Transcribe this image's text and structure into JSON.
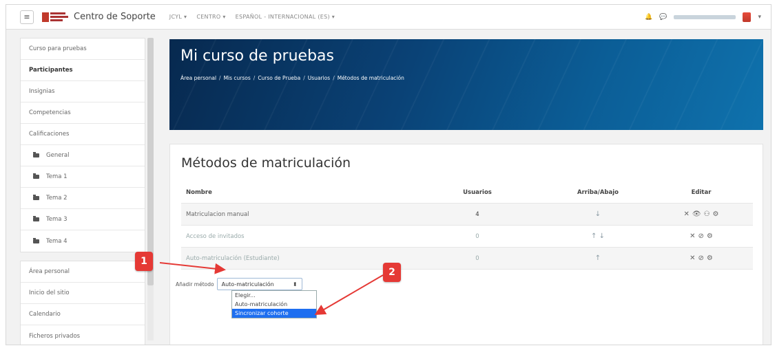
{
  "navbar": {
    "menu_icon": "≡",
    "site_name": "Centro de Soporte",
    "menus": [
      "JCYL ▾",
      "CENTRO ▾",
      "ESPAÑOL - INTERNACIONAL (ES) ▾"
    ]
  },
  "sidebar": {
    "group1": [
      {
        "label": "Curso para pruebas",
        "bold": false,
        "folder": false
      },
      {
        "label": "Participantes",
        "bold": true,
        "folder": false
      },
      {
        "label": "Insignias",
        "bold": false,
        "folder": false
      },
      {
        "label": "Competencias",
        "bold": false,
        "folder": false
      },
      {
        "label": "Calificaciones",
        "bold": false,
        "folder": false
      },
      {
        "label": "General",
        "bold": false,
        "folder": true
      },
      {
        "label": "Tema 1",
        "bold": false,
        "folder": true
      },
      {
        "label": "Tema 2",
        "bold": false,
        "folder": true
      },
      {
        "label": "Tema 3",
        "bold": false,
        "folder": true
      },
      {
        "label": "Tema 4",
        "bold": false,
        "folder": true
      }
    ],
    "group2": [
      {
        "label": "Área personal"
      },
      {
        "label": "Inicio del sitio"
      },
      {
        "label": "Calendario"
      },
      {
        "label": "Ficheros privados"
      }
    ]
  },
  "header": {
    "title": "Mi curso de pruebas",
    "breadcrumb": [
      "Área personal",
      "Mis cursos",
      "Curso de Prueba",
      "Usuarios",
      "Métodos de matriculación"
    ]
  },
  "main": {
    "title": "Métodos de matriculación",
    "columns": [
      "Nombre",
      "Usuarios",
      "Arriba/Abajo",
      "Editar"
    ],
    "rows": [
      {
        "name": "Matriculacion manual",
        "users": "4",
        "move": "↓",
        "edit": [
          "✕",
          "👁",
          "⚇",
          "⚙"
        ],
        "dim": false
      },
      {
        "name": "Acceso de invitados",
        "users": "0",
        "move": "↑ ↓",
        "edit": [
          "✕",
          "⊘",
          "⚙"
        ],
        "dim": true
      },
      {
        "name": "Auto-matriculación (Estudiante)",
        "users": "0",
        "move": "↑",
        "edit": [
          "✕",
          "⊘",
          "⚙"
        ],
        "dim": true
      }
    ],
    "add_method_label": "Añadir método",
    "select_value": "Auto-matriculación",
    "options": [
      "Elegir...",
      "Auto-matriculación",
      "Sincronizar cohorte"
    ],
    "selected_option_index": 2
  },
  "annotations": [
    "1",
    "2"
  ],
  "colors": {
    "badge": "#e53935",
    "selected": "#1e6ff0",
    "banner_dark": "#07294f"
  }
}
